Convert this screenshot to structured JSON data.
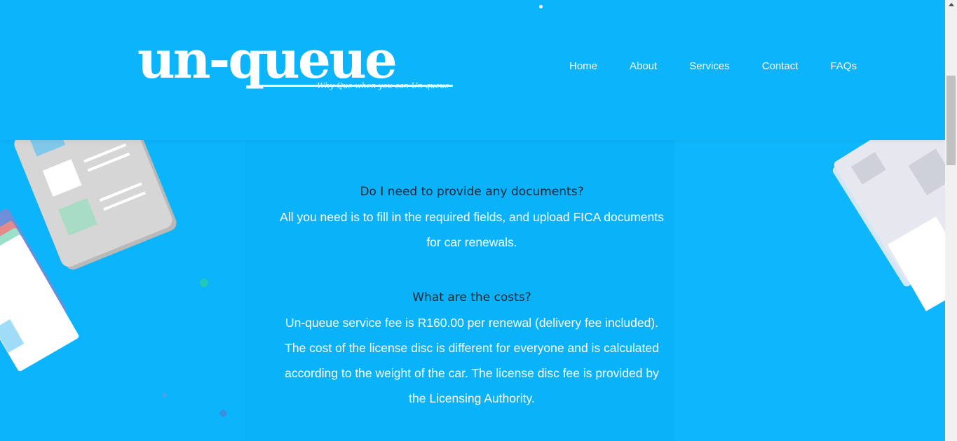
{
  "header": {
    "logo_text": "un-queue",
    "logo_tagline": "Why Que when you can Un-queue",
    "nav": [
      {
        "label": "Home"
      },
      {
        "label": "About"
      },
      {
        "label": "Services"
      },
      {
        "label": "Contact"
      },
      {
        "label": "FAQs"
      }
    ]
  },
  "faq": [
    {
      "question": "Do I need to provide any documents?",
      "answer_lines": [
        "All you need is to fill in the required fields, and upload FICA documents",
        "for car renewals."
      ]
    },
    {
      "question": "What are the costs?",
      "answer_lines": [
        "Un-queue service fee is R160.00 per renewal (delivery fee included).",
        "The cost of the license disc is different for everyone and is calculated",
        "according to the weight of the car. The license disc fee is provided by",
        "the Licensing Authority."
      ]
    }
  ],
  "colors": {
    "background": "#0cb4fc",
    "text_light": "#ffffff",
    "text_dark": "#1a2430"
  },
  "icons": {
    "scroll_up": "chevron-up-icon"
  }
}
